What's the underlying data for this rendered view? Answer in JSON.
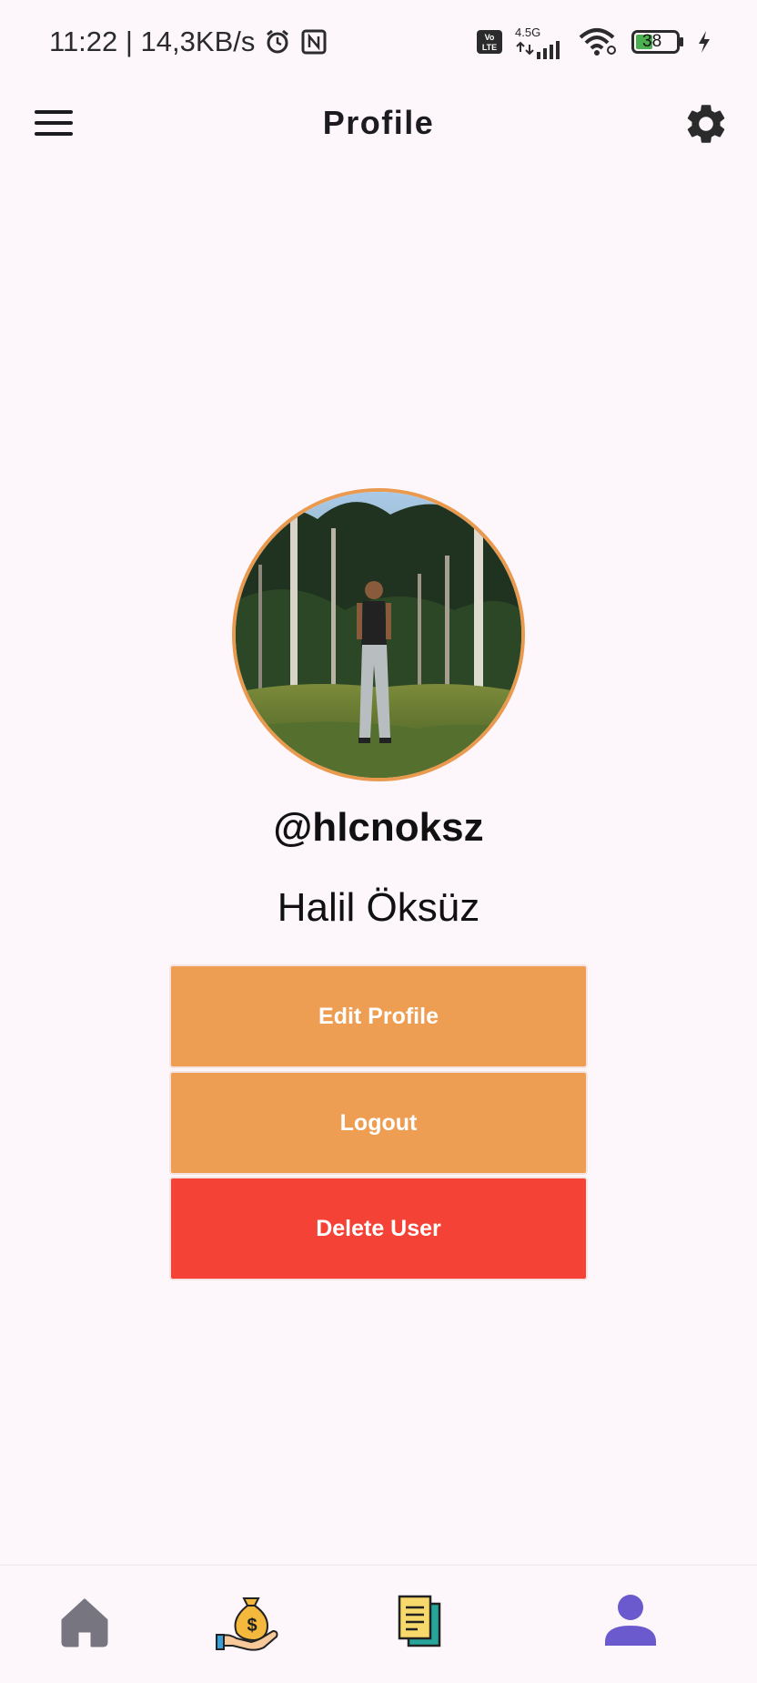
{
  "status_bar": {
    "time_and_speed": "11:22 | 14,3KB/s",
    "network": "4.5G",
    "volte": "Vo LTE",
    "battery": "38"
  },
  "app_bar": {
    "title": "Profile",
    "menu_icon": "hamburger-menu-icon",
    "settings_icon": "gear-icon"
  },
  "profile": {
    "username": "@hlcnoksz",
    "full_name": "Halil Öksüz",
    "avatar_border_color": "#e99a4f"
  },
  "actions": {
    "edit_profile": "Edit Profile",
    "logout": "Logout",
    "delete_user": "Delete User"
  },
  "colors": {
    "primary_button": "#ee9e53",
    "danger_button": "#f44336",
    "active_nav": "#6a5acd",
    "inactive_nav": "#777680"
  },
  "bottom_nav": {
    "items": [
      {
        "icon": "home-icon",
        "active": false
      },
      {
        "icon": "money-bag-icon",
        "active": false
      },
      {
        "icon": "documents-icon",
        "active": false
      },
      {
        "icon": "person-icon",
        "active": true
      }
    ]
  }
}
